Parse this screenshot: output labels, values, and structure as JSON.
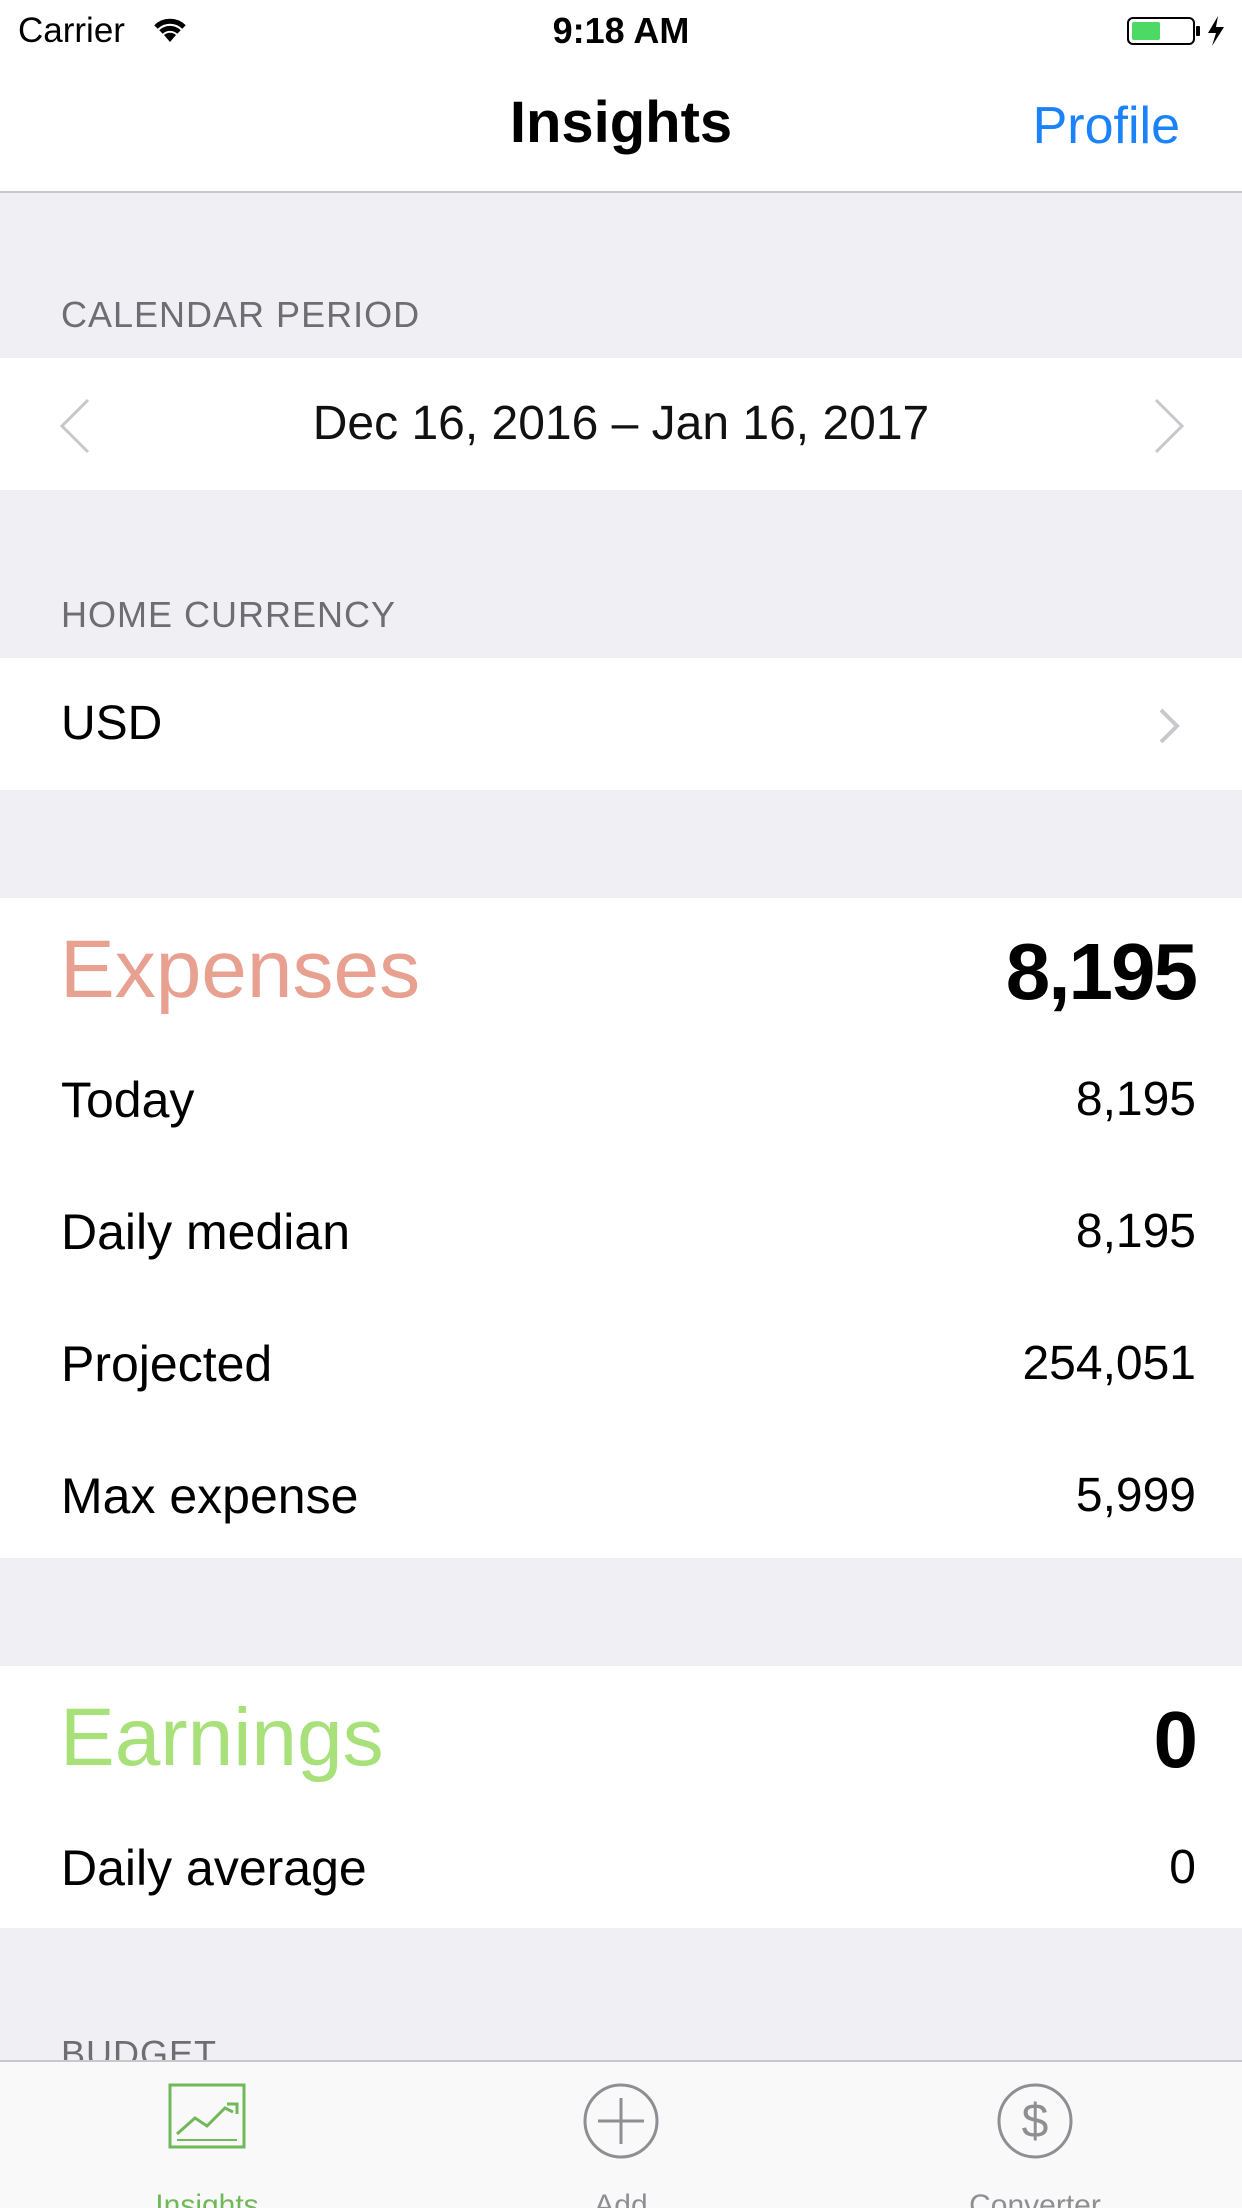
{
  "status_bar": {
    "carrier": "Carrier",
    "time": "9:18 AM"
  },
  "nav": {
    "title": "Insights",
    "right_button": "Profile"
  },
  "calendar_period": {
    "header": "CALENDAR PERIOD",
    "range": "Dec 16, 2016 – Jan 16, 2017"
  },
  "home_currency": {
    "header": "HOME CURRENCY",
    "value": "USD"
  },
  "expenses": {
    "title": "Expenses",
    "total": "8,195",
    "rows": [
      {
        "label": "Today",
        "value": "8,195"
      },
      {
        "label": "Daily median",
        "value": "8,195"
      },
      {
        "label": "Projected",
        "value": "254,051"
      },
      {
        "label": "Max expense",
        "value": "5,999"
      }
    ]
  },
  "earnings": {
    "title": "Earnings",
    "total": "0",
    "rows": [
      {
        "label": "Daily average",
        "value": "0"
      }
    ]
  },
  "budget": {
    "header": "BUDGET"
  },
  "tabs": [
    {
      "label": "Insights",
      "icon": "chart-icon",
      "active": true
    },
    {
      "label": "Add",
      "icon": "plus-circle-icon",
      "active": false
    },
    {
      "label": "Converter",
      "icon": "dollar-circle-icon",
      "active": false
    }
  ],
  "colors": {
    "accent_blue": "#1a82fb",
    "expenses_title": "#e8a090",
    "earnings_title": "#a8e07a",
    "tab_active": "#71b85a",
    "tab_inactive": "#8e8e93",
    "background": "#efeff4",
    "battery_fill": "#4cd964"
  }
}
